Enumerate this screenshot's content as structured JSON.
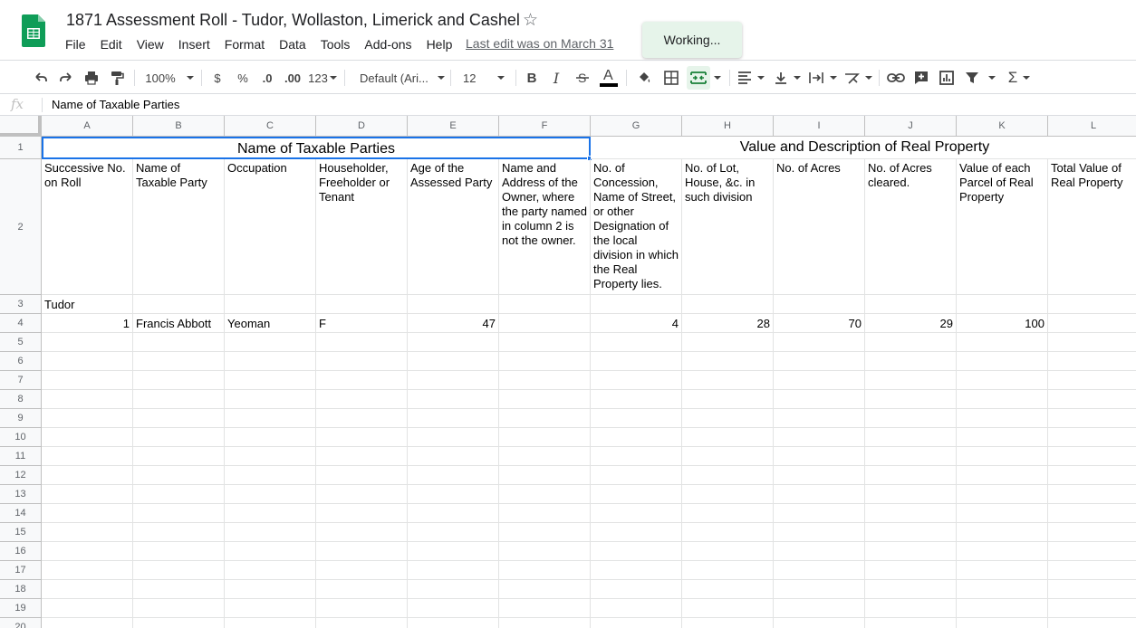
{
  "app": {
    "title": "1871 Assessment Roll - Tudor, Wollaston, Limerick and Cashel",
    "last_edit": "Last edit was on March 31",
    "toast": "Working...",
    "brand_color": "#0f9d58"
  },
  "menu": [
    "File",
    "Edit",
    "View",
    "Insert",
    "Format",
    "Data",
    "Tools",
    "Add-ons",
    "Help"
  ],
  "toolbar": {
    "zoom": "100%",
    "currency": "$",
    "percent": "%",
    "decrease_decimal": ".0",
    "increase_decimal": ".00",
    "more_formats": "123",
    "font": "Default (Ari...",
    "font_size": "12",
    "icons": [
      "undo-icon",
      "redo-icon",
      "print-icon",
      "paint-format-icon",
      "bold-icon",
      "italic-icon",
      "strikethrough-icon",
      "text-color-icon",
      "fill-color-icon",
      "borders-icon",
      "merge-cells-icon",
      "align-icon",
      "valign-icon",
      "wrap-icon",
      "rotate-icon",
      "link-icon",
      "comment-icon",
      "chart-icon",
      "filter-icon",
      "functions-icon"
    ]
  },
  "formula_bar": {
    "fx": "fx",
    "content": "Name of Taxable Parties"
  },
  "columns": [
    "A",
    "B",
    "C",
    "D",
    "E",
    "F",
    "G",
    "H",
    "I",
    "J",
    "K",
    "L"
  ],
  "rows": [
    "1",
    "2",
    "3",
    "4",
    "5",
    "6",
    "7",
    "8",
    "9",
    "10",
    "11",
    "12",
    "13",
    "14",
    "15",
    "16",
    "17",
    "18",
    "19",
    "20"
  ],
  "sheet": {
    "row1": {
      "merged_left": "Name of Taxable Parties",
      "merged_right": "Value and Description of Real Property"
    },
    "row2": [
      "Successive No. on Roll",
      "Name of Taxable Party",
      "Occupation",
      "Householder, Freeholder or Tenant",
      "Age of the Assessed Party",
      "Name and Address of the Owner, where the party named in column 2 is not the owner.",
      "No. of Concession, Name of Street, or other Designation of the local division in which the Real Property lies.",
      "No. of Lot, House, &c. in such division",
      "No. of Acres",
      "No. of Acres cleared.",
      "Value of each Parcel of Real Property",
      "Total Value of Real Property"
    ],
    "row3": [
      "Tudor",
      "",
      "",
      "",
      "",
      "",
      "",
      "",
      "",
      "",
      "",
      ""
    ],
    "row4": [
      "1",
      "Francis Abbott",
      "Yeoman",
      "F",
      "47",
      "",
      "4",
      "28",
      "70",
      "29",
      "100",
      ""
    ]
  }
}
